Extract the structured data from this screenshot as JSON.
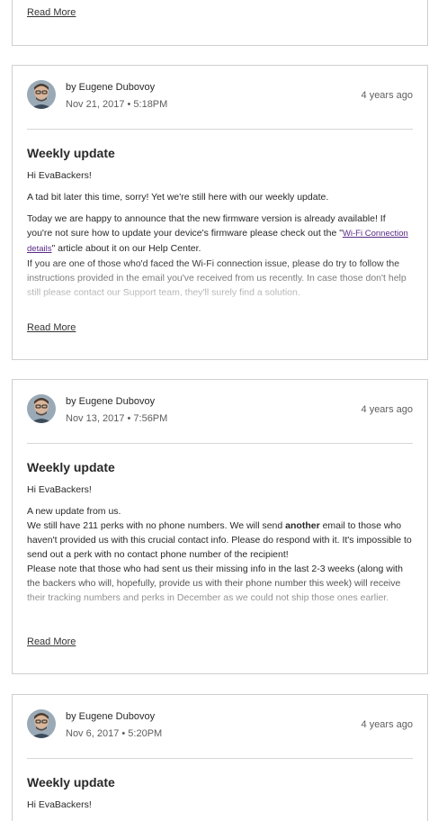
{
  "read_more_label": "Read More",
  "updates": [
    {
      "author": "by Eugene Dubovoy",
      "date": "Nov 21, 2017 • 5:18PM",
      "ago": "4 years ago",
      "title": "Weekly update",
      "greeting": "Hi EvaBackers!",
      "p1": "A tad bit later this time, sorry! Yet we're still here with our weekly update.",
      "p2_pre": "Today we are happy to announce that the new firmware version is already available! If you're not sure how to update your device's firmware please check out the \"",
      "p2_link": "Wi-Fi Connection details",
      "p2_post": "\" article about it on our Help Center.",
      "p3": "If you are one of those who'd faced the Wi-Fi connection issue, please do try to follow the instructions provided in the email you've received from us recently. In case those don't help still please contact our Support team, they'll surely find a solution."
    },
    {
      "author": "by Eugene Dubovoy",
      "date": "Nov 13, 2017 • 7:56PM",
      "ago": "4 years ago",
      "title": "Weekly update",
      "greeting": "Hi EvaBackers!",
      "p1": "A new update from us.",
      "p2_pre": "We still have 211 perks with no phone numbers. We will send ",
      "p2_bold": "another",
      "p2_post": " email to those who haven't provided us with this crucial contact info. Please do respond with it. It's impossible to send out a perk with no contact phone number of the recipient!",
      "p3": "Please note that those who had sent us their missing info in the last 2-3 weeks (along with the backers who will, hopefully, provide us with their phone number this week) will receive their tracking numbers and perks in December as we could not ship those ones earlier."
    },
    {
      "author": "by Eugene Dubovoy",
      "date": "Nov 6, 2017 • 5:20PM",
      "ago": "4 years ago",
      "title": "Weekly update",
      "greeting": "Hi EvaBackers!"
    }
  ]
}
